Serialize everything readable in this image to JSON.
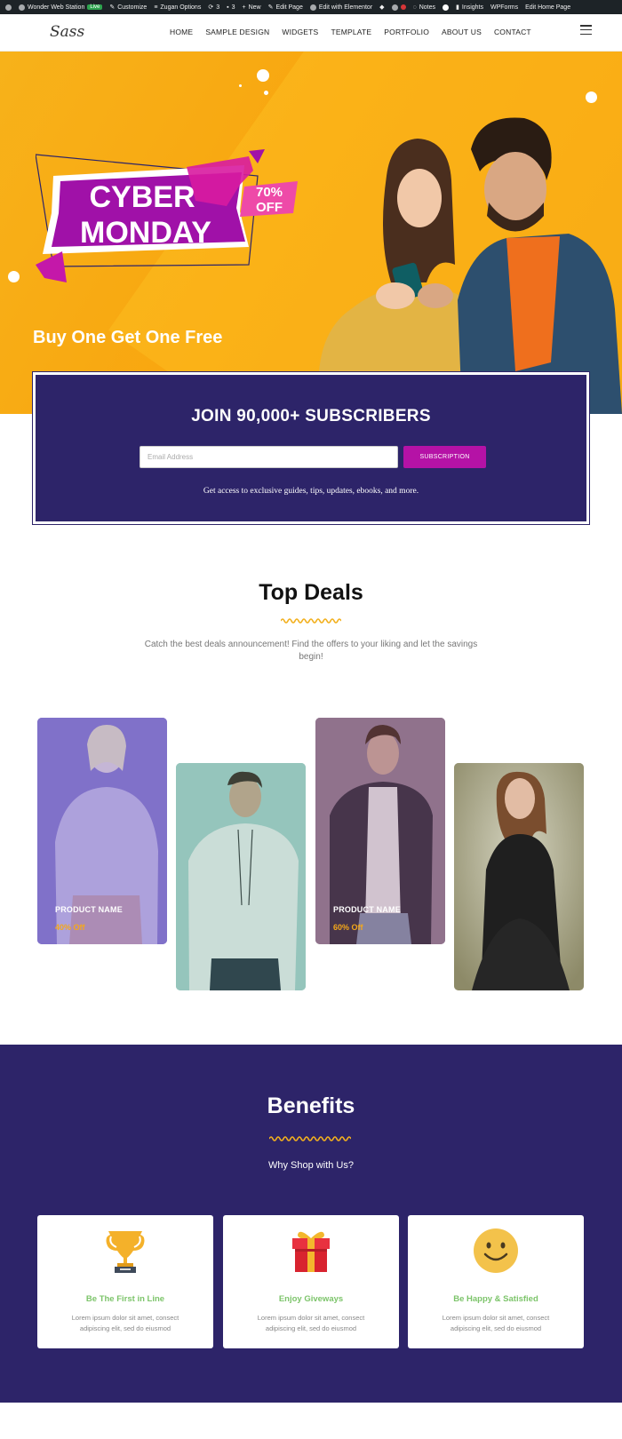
{
  "admin_bar": {
    "site_name": "Wonder Web Station",
    "live_badge": "Live",
    "customize": "Customize",
    "zugan": "Zugan Options",
    "updates_count": "3",
    "comments_count": "3",
    "new": "New",
    "edit_page": "Edit Page",
    "edit_elementor": "Edit with Elementor",
    "notes": "Notes",
    "insights": "Insights",
    "wpforms": "WPForms",
    "edit_home": "Edit Home Page"
  },
  "header": {
    "logo": "Sass",
    "nav": [
      "HOME",
      "SAMPLE DESIGN",
      "WIDGETS",
      "TEMPLATE",
      "PORTFOLIO",
      "ABOUT US",
      "CONTACT"
    ]
  },
  "hero": {
    "line1": "CYBER",
    "line2": "MONDAY",
    "discount_1": "70%",
    "discount_2": "OFF",
    "tagline": "Buy One Get One Free"
  },
  "subscribe": {
    "title": "JOIN 90,000+ SUBSCRIBERS",
    "email_placeholder": "Email Address",
    "button": "SUBSCRIPTION",
    "note": "Get access to exclusive guides, tips, updates, ebooks, and more."
  },
  "deals": {
    "title": "Top Deals",
    "description": "Catch the best deals announcement! Find the offers to your liking and let the savings begin!",
    "cards": [
      {
        "name": "PRODUCT NAME",
        "off": "40% Off"
      },
      {
        "name": "",
        "off": ""
      },
      {
        "name": "PRODUCT NAME",
        "off": "60% Off"
      },
      {
        "name": "",
        "off": ""
      }
    ]
  },
  "benefits": {
    "title": "Benefits",
    "subtitle": "Why Shop with Us?",
    "items": [
      {
        "icon": "trophy-icon",
        "label": "Be The First in Line",
        "text": "Lorem ipsum dolor sit amet, consect adipiscing elit, sed do eiusmod"
      },
      {
        "icon": "gift-icon",
        "label": "Enjoy Giveways",
        "text": "Lorem ipsum dolor sit amet, consect adipiscing elit, sed do eiusmod"
      },
      {
        "icon": "smiley-icon",
        "label": "Be Happy & Satisfied",
        "text": "Lorem ipsum dolor sit amet, consect adipiscing elit, sed do eiusmod"
      }
    ]
  },
  "colors": {
    "brand_purple": "#2d2469",
    "accent_magenta": "#b512a6",
    "hero_orange": "#f7b21a",
    "benefit_green": "#7cc46a"
  }
}
